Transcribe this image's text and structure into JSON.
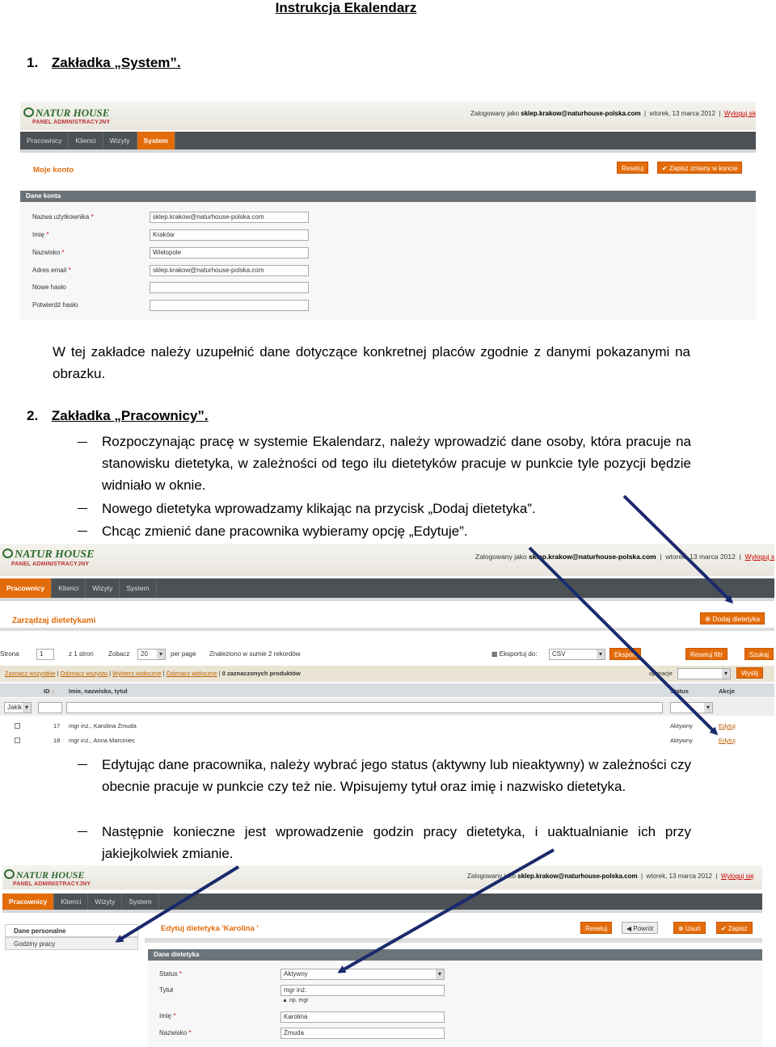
{
  "doc": {
    "title": "Instrukcja Ekalendarz",
    "s1_num": "1.",
    "s1_label": "Zakładka „System”.",
    "p1": "W tej zakładce należy uzupełnić dane dotyczące konkretnej placów zgodnie z danymi pokazanymi na obrazku.",
    "s2_num": "2.",
    "s2_label": "Zakładka „Pracownicy”.",
    "b1": "Rozpoczynając pracę w systemie Ekalendarz, należy wprowadzić dane osoby, która pracuje na stanowisku dietetyka, w zależności od tego ilu dietetyków pracuje w punkcie tyle pozycji będzie widniało w oknie.",
    "b2": "Nowego dietetyka wprowadzamy klikając na przycisk „Dodaj dietetyka”.",
    "b3": "Chcąc zmienić dane pracownika wybieramy opcję „Edytuje”.",
    "b4": "Edytując dane pracownika, należy wybrać jego status (aktywny lub nieaktywny) w zależności czy obecnie pracuje w punkcie czy też nie. Wpisujemy tytuł oraz imię i nazwisko dietetyka.",
    "b5": "Następnie konieczne jest wprowadzenie godzin pracy dietetyka, i uaktualnianie ich przy jakiejkolwiek zmianie."
  },
  "brand": {
    "name": "NATUR HOUSE",
    "sub": "PANEL ADMINISTRACYJNY",
    "green": "#2d6a2e",
    "orange": "#e36c0a",
    "nav_bg": "#4b5155"
  },
  "shot1": {
    "login_prefix": "Zalogowany jako",
    "login_user": "sklep.krakow@naturhouse-polska.com",
    "date": "wtorek, 13 marca 2012",
    "logout": "Wyloguj się",
    "nav": [
      "Pracownicy",
      "Klienci",
      "Wizyty",
      "System"
    ],
    "page_title": "Moje konto",
    "reset": "Resetuj",
    "save": "Zapisz zmiany w koncie",
    "section": "Dane konta",
    "fields": [
      {
        "label": "Nazwa użytkownika",
        "req": "*",
        "value": "sklep.krakow@naturhouse-polska.com"
      },
      {
        "label": "Imię",
        "req": "*",
        "value": "Kraków"
      },
      {
        "label": "Nazwisko",
        "req": "*",
        "value": "Wielopole"
      },
      {
        "label": "Adres email",
        "req": "*",
        "value": "sklep.krakow@naturhouse-polska.com"
      },
      {
        "label": "Nowe hasło",
        "req": "",
        "value": ""
      },
      {
        "label": "Potwierdź hasło",
        "req": "",
        "value": ""
      }
    ]
  },
  "shot2": {
    "login_prefix": "Zalogowany jako",
    "login_user": "sklep.krakow@naturhouse-polska.com",
    "date": "wtorek, 13 marca 2012",
    "logout": "Wyloguj się",
    "nav": [
      "Pracownicy",
      "Klienci",
      "Wizyty",
      "System"
    ],
    "page_title": "Zarządzaj dietetykami",
    "add_btn": "Dodaj dietetyka",
    "pager": {
      "strona": "Strona",
      "page": "1",
      "of": "z 1 stron",
      "show": "Zobacz",
      "per_page_val": "20",
      "per_page": "per page",
      "found": "Znaleziono w sumie 2 rekordów"
    },
    "export_label": "Eksportuj do:",
    "export_val": "CSV",
    "export_btn": "Eksport",
    "reset_filter": "Resetuj filtr",
    "search": "Szukaj",
    "mass": {
      "select_all": "Zaznacz wszystkie",
      "unselect_all": "Odznacz wszysto",
      "select_visible": "Wybierz widoczne",
      "unselect_visible": "Odznacz widoczne",
      "selected": "0 zaznaczonych produktów",
      "ops": "operacje",
      "send": "Wyślij"
    },
    "cols": {
      "id": "ID",
      "name": "Imie, nazwisko, tytuł",
      "status": "Status",
      "actions": "Akcje"
    },
    "filter_any": "Jakik",
    "rows": [
      {
        "id": "17",
        "name": "mgr inż., Karolina Żmuda",
        "status": "Aktywny",
        "action": "Edytuj"
      },
      {
        "id": "18",
        "name": "mgr inż., Anna Marciniec",
        "status": "Aktywny",
        "action": "Edytuj"
      }
    ]
  },
  "shot3": {
    "login_prefix": "Zalogowany jako",
    "login_user": "sklep.krakow@naturhouse-polska.com",
    "date": "wtorek, 13 marca 2012",
    "logout": "Wyloguj się",
    "nav": [
      "Pracownicy",
      "Klienci",
      "Wizyty",
      "System"
    ],
    "left": [
      "Dane personalne",
      "Godziny pracy"
    ],
    "page_title": "Edytuj dietetyka 'Karolina '",
    "reset": "Resetuj",
    "back": "Powrót",
    "delete": "Usuń",
    "save": "Zapisz",
    "section": "Dane dietetyka",
    "fields": [
      {
        "label": "Status",
        "req": "*",
        "value": "Aktywny"
      },
      {
        "label": "Tytuł",
        "req": "",
        "value": "mgr inż."
      },
      {
        "label": "Imię",
        "req": "*",
        "value": "Karolina"
      },
      {
        "label": "Nazwisko",
        "req": "*",
        "value": "Żmuda"
      }
    ],
    "hint": "np. mgr"
  }
}
